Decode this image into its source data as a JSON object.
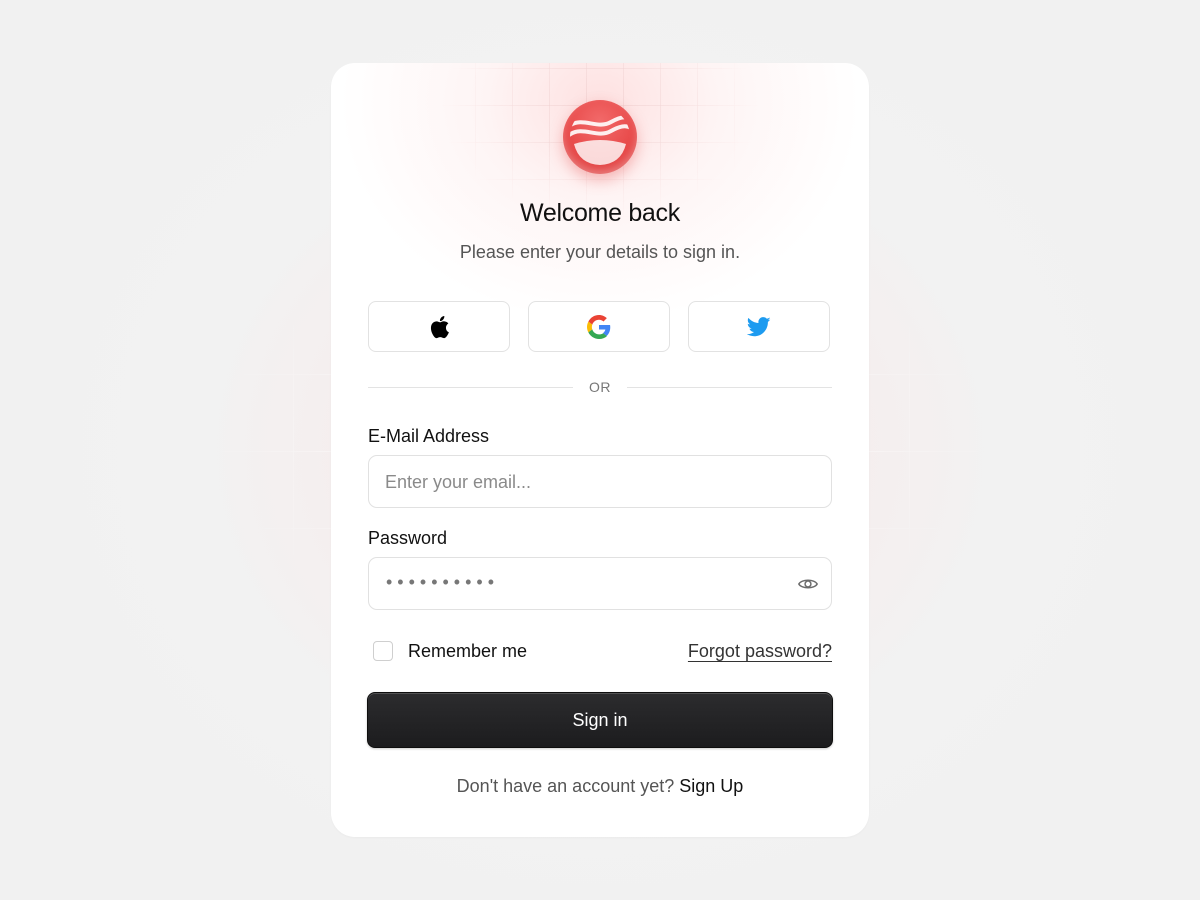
{
  "header": {
    "title": "Welcome back",
    "subtitle": "Please enter your details to sign in."
  },
  "social": {
    "apple_icon": "apple-icon",
    "google_icon": "google-icon",
    "twitter_icon": "twitter-icon"
  },
  "divider": {
    "label": "OR"
  },
  "form": {
    "email_label": "E-Mail Address",
    "email_placeholder": "Enter your email...",
    "password_label": "Password",
    "password_mask": "••••••••••",
    "remember_label": "Remember me",
    "forgot_link": "Forgot password?",
    "submit_label": "Sign in"
  },
  "footer": {
    "prompt": "Don't have an account yet?",
    "signup_link": "Sign Up"
  },
  "colors": {
    "brand": "#e84a4a",
    "button_dark": "#1f1f21",
    "twitter_blue": "#1d9bf0"
  }
}
